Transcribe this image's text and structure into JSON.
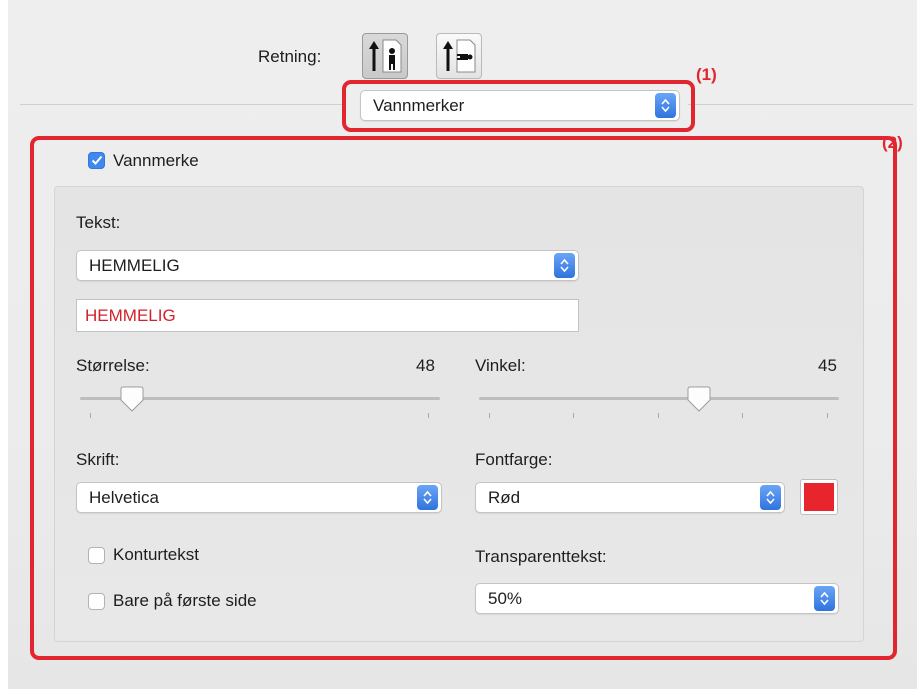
{
  "orientation": {
    "label": "Retning:",
    "options": [
      "portrait-icon",
      "landscape-icon"
    ],
    "selected": "portrait-icon"
  },
  "panel_select": {
    "value": "Vannmerker",
    "callout": "(1)"
  },
  "watermark_section": {
    "callout": "(2)",
    "enable_checkbox": {
      "label": "Vannmerke",
      "checked": true
    },
    "text": {
      "label": "Tekst:",
      "preset": "HEMMELIG",
      "custom_value": "HEMMELIG"
    },
    "size": {
      "label": "Størrelse:",
      "value": "48",
      "slider_fraction": 0.12
    },
    "angle": {
      "label": "Vinkel:",
      "value": "45",
      "slider_fraction": 0.62
    },
    "font": {
      "label": "Skrift:",
      "value": "Helvetica"
    },
    "font_color": {
      "label": "Fontfarge:",
      "value": "Rød",
      "swatch_color": "#e8252d"
    },
    "outline_text": {
      "label": "Konturtekst",
      "checked": false
    },
    "first_page_only": {
      "label": "Bare på første side",
      "checked": false
    },
    "transparency": {
      "label": "Transparenttekst:",
      "value": "50%"
    }
  },
  "colors": {
    "highlight": "#e2262f",
    "accent": "#3f88f0",
    "custom_text": "#d1222b"
  }
}
